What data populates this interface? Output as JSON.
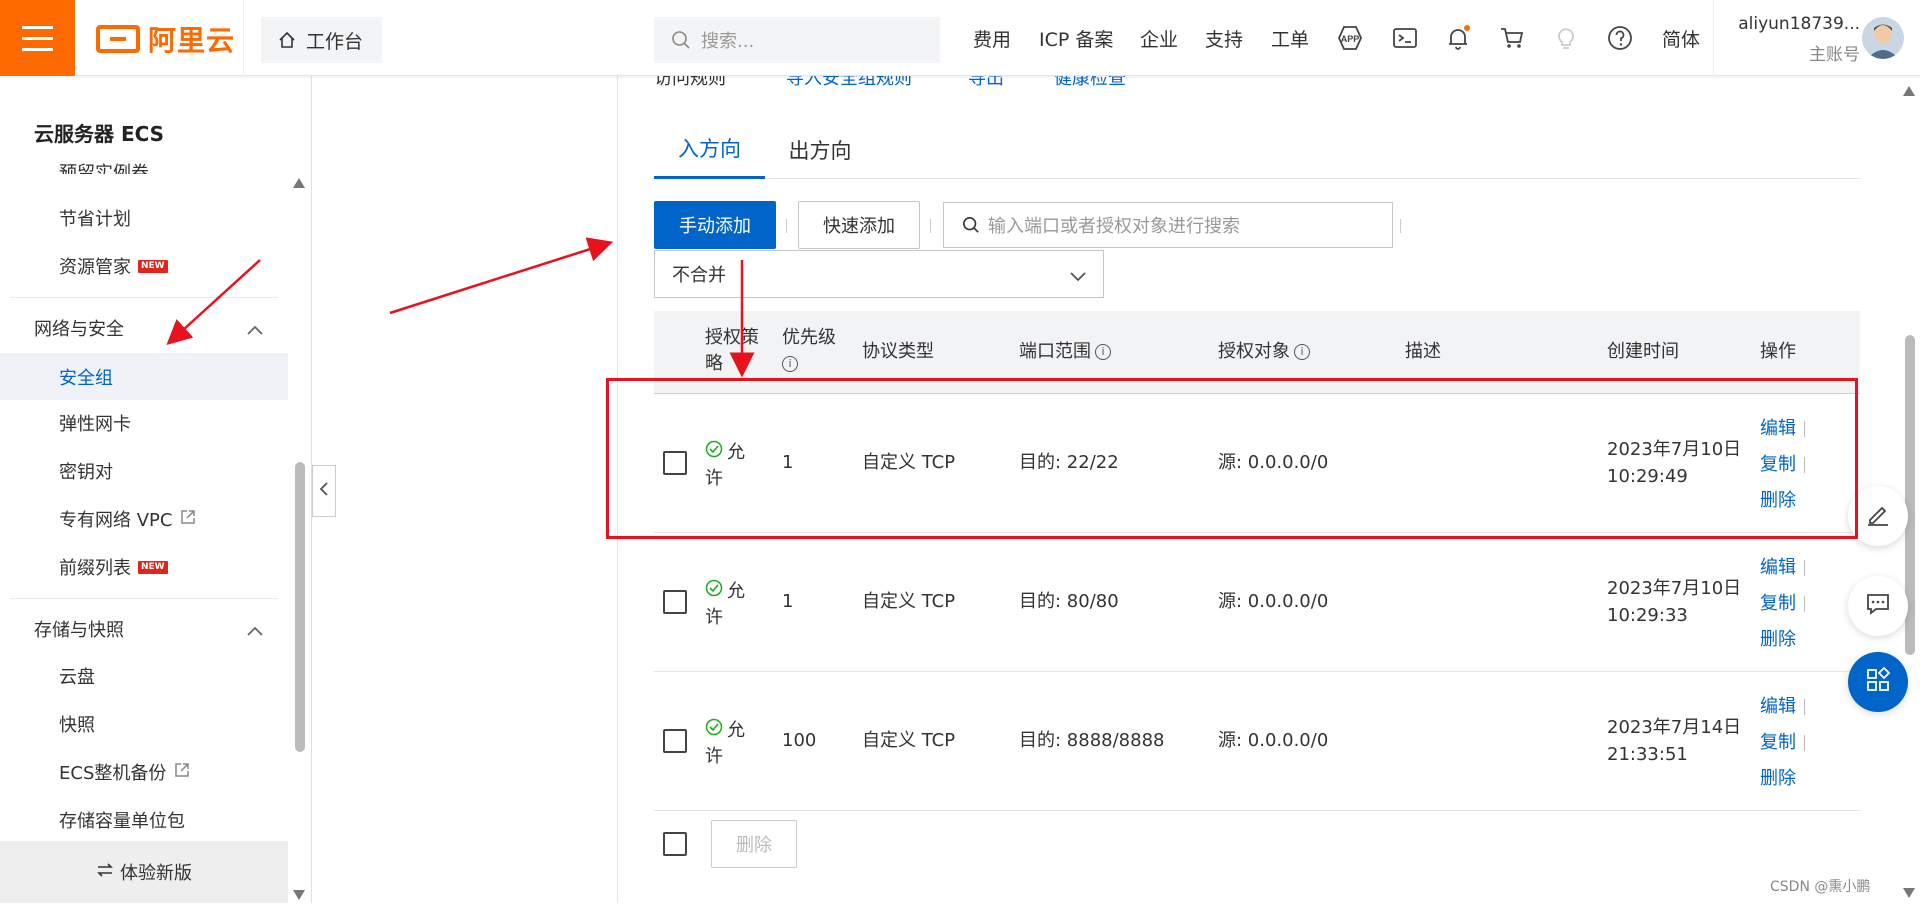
{
  "header": {
    "brand": "阿里云",
    "workbench_label": "工作台",
    "search_placeholder": "搜索...",
    "nav": [
      "费用",
      "ICP 备案",
      "企业",
      "支持",
      "工单"
    ],
    "lang": "简体",
    "user_name": "aliyun18739...",
    "user_role": "主账号"
  },
  "sidebar": {
    "title": "云服务器 ECS",
    "partial_item": "预留实例券",
    "items_top": [
      {
        "label": "节省计划"
      },
      {
        "label": "资源管家",
        "badge": "NEW"
      }
    ],
    "group_network": "网络与安全",
    "network_items": [
      {
        "label": "安全组",
        "active": true
      },
      {
        "label": "弹性网卡"
      },
      {
        "label": "密钥对"
      },
      {
        "label": "专有网络 VPC",
        "external": true
      },
      {
        "label": "前缀列表",
        "badge": "NEW"
      }
    ],
    "group_storage": "存储与快照",
    "storage_items": [
      {
        "label": "云盘"
      },
      {
        "label": "快照"
      },
      {
        "label": "ECS整机备份",
        "external": true
      },
      {
        "label": "存储容量单位包"
      }
    ],
    "footer_label": "体验新版"
  },
  "partial_toolbar": {
    "label": "访问规则",
    "links": [
      "导入安全组规则",
      "导出",
      "健康检查"
    ]
  },
  "tabs": [
    "入方向",
    "出方向"
  ],
  "toolbar": {
    "manual_add": "手动添加",
    "quick_add": "快速添加",
    "search_placeholder": "输入端口或者授权对象进行搜索",
    "merge_select": "不合并"
  },
  "table": {
    "headers": {
      "policy": "授权策略",
      "priority": "优先级",
      "protocol": "协议类型",
      "port": "端口范围",
      "source": "授权对象",
      "desc": "描述",
      "created": "创建时间",
      "ops": "操作"
    },
    "rows": [
      {
        "policy": "允许",
        "priority": "1",
        "protocol": "自定义 TCP",
        "port": "目的: 22/22",
        "source": "源: 0.0.0.0/0",
        "date": "2023年7月10日",
        "time": "10:29:49"
      },
      {
        "policy": "允许",
        "priority": "1",
        "protocol": "自定义 TCP",
        "port": "目的: 80/80",
        "source": "源: 0.0.0.0/0",
        "date": "2023年7月10日",
        "time": "10:29:33"
      },
      {
        "policy": "允许",
        "priority": "100",
        "protocol": "自定义 TCP",
        "port": "目的: 8888/8888",
        "source": "源: 0.0.0.0/0",
        "date": "2023年7月14日",
        "time": "21:33:51"
      }
    ],
    "ops": {
      "edit": "编辑",
      "copy": "复制",
      "delete": "删除"
    },
    "bulk_delete": "删除"
  },
  "watermark": "CSDN @熏小鹏",
  "colors": {
    "brand": "#ff6a00",
    "primary": "#0064c8",
    "annotation": "#e8121f",
    "success": "#1aad19"
  }
}
